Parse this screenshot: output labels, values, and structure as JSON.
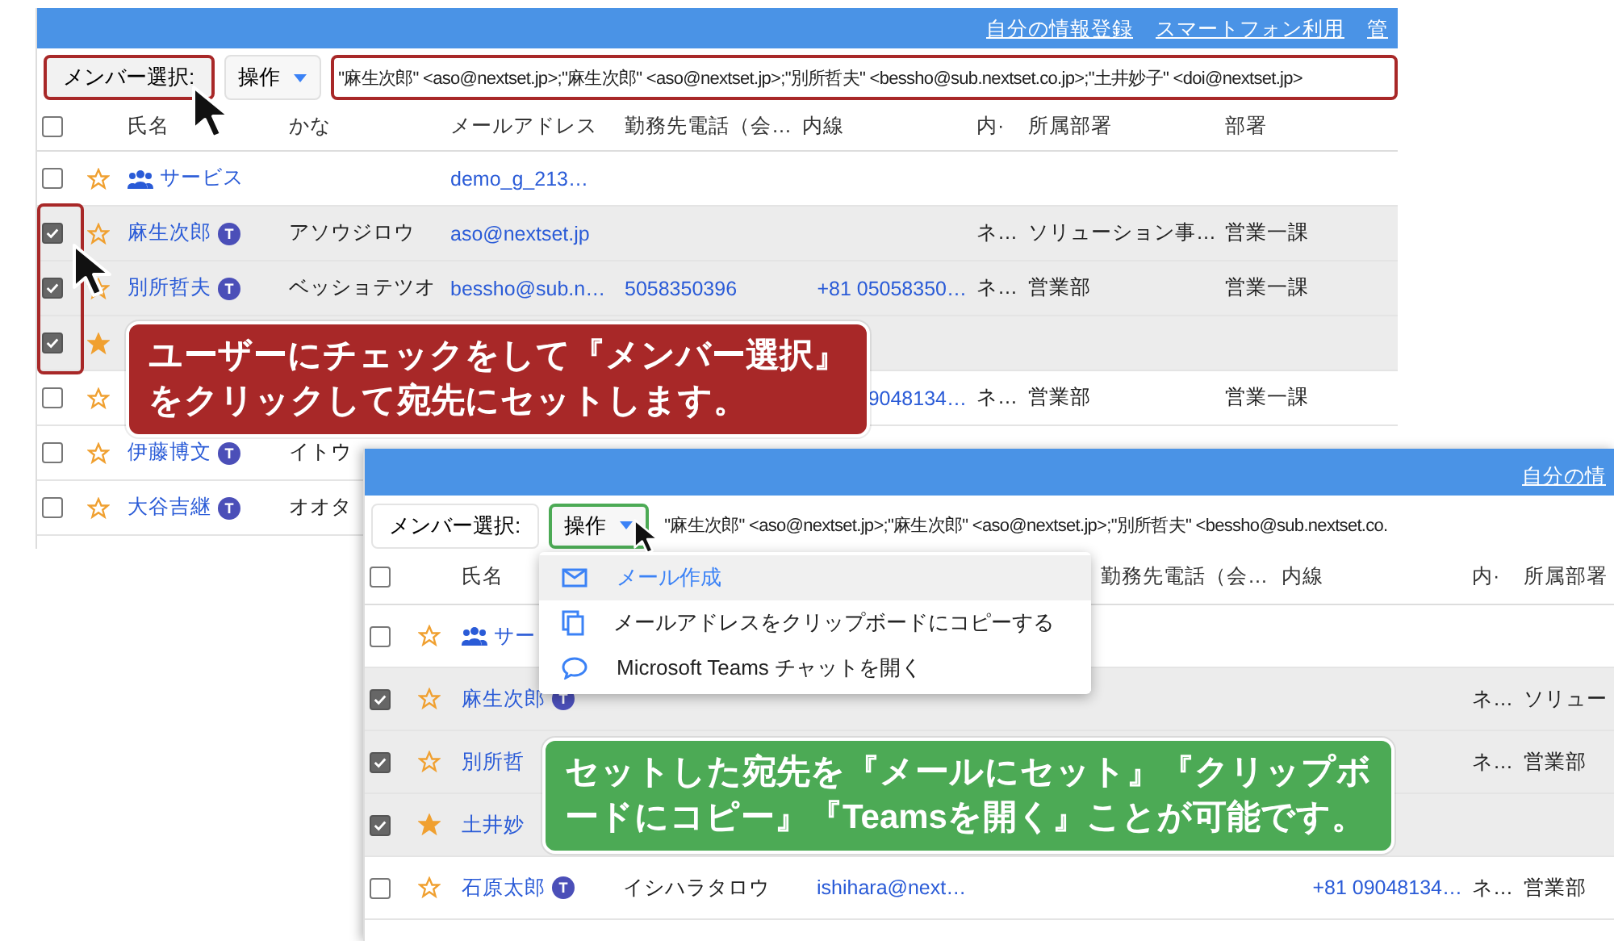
{
  "panels": [
    {
      "header_links": [
        "自分の情報登録",
        "スマートフォン利用",
        "管"
      ],
      "member_select": {
        "label": "メンバー選択:",
        "highlighted": true
      },
      "action_button": {
        "label": "操作",
        "highlighted": false
      },
      "recipients": {
        "value": "\"麻生次郎\" <aso@nextset.jp>;\"麻生次郎\" <aso@nextset.jp>;\"別所哲夫\" <bessho@sub.nextset.co.jp>;\"土井妙子\" <doi@nextset.jp>",
        "highlighted": true
      },
      "checked_rows_highlighted": true,
      "all_checked": false,
      "columns": [
        "氏名",
        "かな",
        "メールアドレス",
        "勤務先電話（会…",
        "内線",
        "内·",
        "所属部署",
        "部署"
      ],
      "rows": [
        {
          "kind": "group",
          "checked": false,
          "starred": false,
          "cells": [
            "サービス",
            null,
            "demo_g_213…",
            null,
            null,
            null,
            null,
            null
          ]
        },
        {
          "kind": "person",
          "checked": true,
          "starred": false,
          "badge": "T",
          "cells": [
            "麻生次郎",
            "アソウジロウ",
            "aso@nextset.jp",
            null,
            null,
            "ネ…",
            "ソリューション事…",
            "営業一課"
          ]
        },
        {
          "kind": "person",
          "checked": true,
          "starred": false,
          "badge": "T",
          "cells": [
            "別所哲夫",
            "ベッショテツオ",
            "bessho@sub.n…",
            "5058350396",
            "+81 05058350…",
            "ネ…",
            "営業部",
            "営業一課"
          ]
        },
        {
          "kind": "person",
          "checked": true,
          "starred": true,
          "cells": []
        },
        {
          "kind": "person",
          "checked": false,
          "starred": false,
          "cells": [
            null,
            null,
            null,
            null,
            "9048134…",
            "ネ…",
            "営業部",
            "営業一課"
          ]
        },
        {
          "kind": "person",
          "checked": false,
          "starred": false,
          "badge": "T",
          "cells": [
            "伊藤博文",
            "イトウ"
          ]
        },
        {
          "kind": "person",
          "checked": false,
          "starred": false,
          "badge": "T",
          "cells": [
            "大谷吉継",
            "オオタ"
          ]
        }
      ],
      "callout": {
        "lines": [
          "ユーザーにチェックをして『メンバー選択』",
          "をクリックして宛先にセットします。"
        ],
        "color": "#a82828"
      }
    },
    {
      "header_links": [
        "自分の情"
      ],
      "member_select": {
        "label": "メンバー選択:",
        "highlighted": false
      },
      "action_button": {
        "label": "操作",
        "highlighted": true
      },
      "recipients": {
        "value": "\"麻生次郎\" <aso@nextset.jp>;\"麻生次郎\" <aso@nextset.jp>;\"別所哲夫\" <bessho@sub.nextset.co.",
        "highlighted": false
      },
      "all_checked": false,
      "columns": [
        "氏名",
        null,
        null,
        "勤務先電話（会…",
        "内線",
        "内·",
        "所属部署"
      ],
      "rows": [
        {
          "kind": "group",
          "checked": false,
          "starred": false,
          "cells": [
            "サー"
          ]
        },
        {
          "kind": "person",
          "checked": true,
          "starred": false,
          "badge": "T",
          "cells": [
            "麻生次郎",
            null,
            null,
            null,
            null,
            "ネ…",
            "ソリュー"
          ]
        },
        {
          "kind": "person",
          "checked": true,
          "starred": false,
          "cells": [
            "別所哲",
            null,
            null,
            null,
            null,
            "ネ…",
            "営業部"
          ]
        },
        {
          "kind": "person",
          "checked": true,
          "starred": true,
          "cells": [
            "土井妙"
          ]
        },
        {
          "kind": "person",
          "checked": false,
          "starred": false,
          "badge": "T",
          "cells": [
            "石原太郎",
            "イシハラタロウ",
            "ishihara@next…",
            null,
            "+81 09048134…",
            "ネ…",
            "営業部"
          ]
        }
      ],
      "menu": [
        {
          "kind": "mail",
          "label": "メール作成",
          "selected": true
        },
        {
          "kind": "copy",
          "label": "メールアドレスをクリップボードにコピーする",
          "selected": false
        },
        {
          "kind": "chat",
          "label": "Microsoft Teams チャットを開く",
          "selected": false
        }
      ],
      "callout": {
        "lines": [
          "セットした宛先を『メールにセット』『クリップボ",
          "ードにコピー』『Teamsを開く』ことが可能です。"
        ],
        "color": "#4caa55"
      }
    }
  ]
}
